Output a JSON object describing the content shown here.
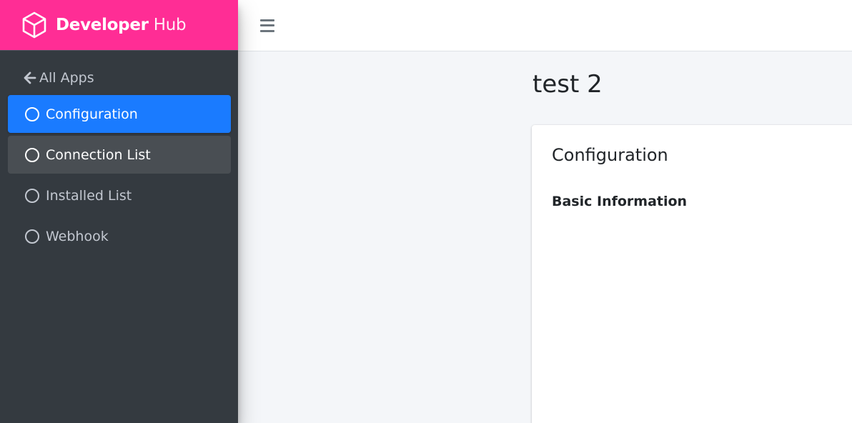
{
  "brand": {
    "name_bold": "Developer",
    "name_light": "Hub",
    "logo_icon": "cube-icon",
    "color": "#ff2d95"
  },
  "sidebar": {
    "back_label": "All Apps",
    "back_icon": "arrow-left-icon",
    "items": [
      {
        "label": "Configuration",
        "state": "active",
        "icon": "circle-icon"
      },
      {
        "label": "Connection List",
        "state": "hover",
        "icon": "circle-icon"
      },
      {
        "label": "Installed List",
        "state": "normal",
        "icon": "circle-icon"
      },
      {
        "label": "Webhook",
        "state": "normal",
        "icon": "circle-icon"
      }
    ],
    "background": "#343a40",
    "active_color": "#1a7bff"
  },
  "topbar": {
    "menu_icon": "hamburger-icon"
  },
  "main": {
    "page_title": "test 2",
    "card": {
      "title": "Configuration",
      "section_heading": "Basic Information"
    }
  }
}
